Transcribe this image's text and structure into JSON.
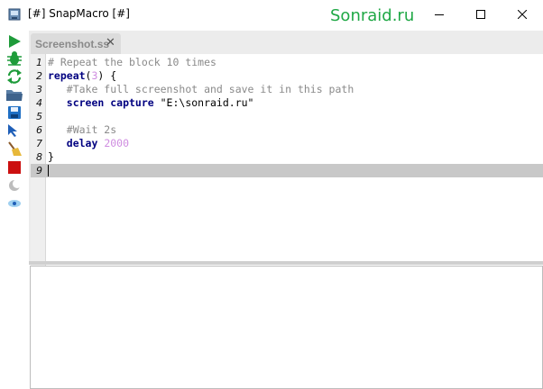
{
  "window": {
    "title": "[#] SnapMacro [#]",
    "watermark": "Sonraid.ru",
    "controls": [
      "minimize",
      "maximize",
      "close"
    ]
  },
  "toolbar": {
    "icons": [
      "run-icon",
      "debug-bug-icon",
      "reload-icon",
      "open-folder-icon",
      "save-icon",
      "pointer-icon",
      "clear-broom-icon",
      "stop-icon",
      "moon-icon",
      "eye-icon"
    ]
  },
  "editor": {
    "tab_label": "Screenshot.ss",
    "tab_close": "✕",
    "current_line": 9,
    "lines": [
      {
        "num": "1",
        "segments": [
          {
            "t": "# Repeat the block 10 times",
            "c": "comment"
          }
        ]
      },
      {
        "num": "2",
        "segments": [
          {
            "t": "repeat",
            "c": "kw"
          },
          {
            "t": "(",
            "c": "plain"
          },
          {
            "t": "3",
            "c": "num"
          },
          {
            "t": ") {",
            "c": "plain"
          }
        ]
      },
      {
        "num": "3",
        "segments": [
          {
            "t": "   #Take full screenshot and save it in this path",
            "c": "comment"
          }
        ]
      },
      {
        "num": "4",
        "segments": [
          {
            "t": "   screen capture ",
            "c": "kw"
          },
          {
            "t": "\"E:\\sonraid.ru\"",
            "c": "str"
          }
        ]
      },
      {
        "num": "5",
        "segments": [
          {
            "t": "",
            "c": "plain"
          }
        ]
      },
      {
        "num": "6",
        "segments": [
          {
            "t": "   #Wait 2s",
            "c": "comment"
          }
        ]
      },
      {
        "num": "7",
        "segments": [
          {
            "t": "   delay ",
            "c": "kw"
          },
          {
            "t": "2000",
            "c": "num"
          }
        ]
      },
      {
        "num": "8",
        "segments": [
          {
            "t": "}",
            "c": "plain"
          }
        ]
      },
      {
        "num": "9",
        "segments": [
          {
            "t": "",
            "c": "plain"
          }
        ]
      }
    ]
  },
  "colors": {
    "watermark": "#1fa845",
    "keyword": "#000080",
    "comment": "#8a8a8a",
    "number": "#cf8ce0",
    "current_line": "#c8c8c8"
  }
}
